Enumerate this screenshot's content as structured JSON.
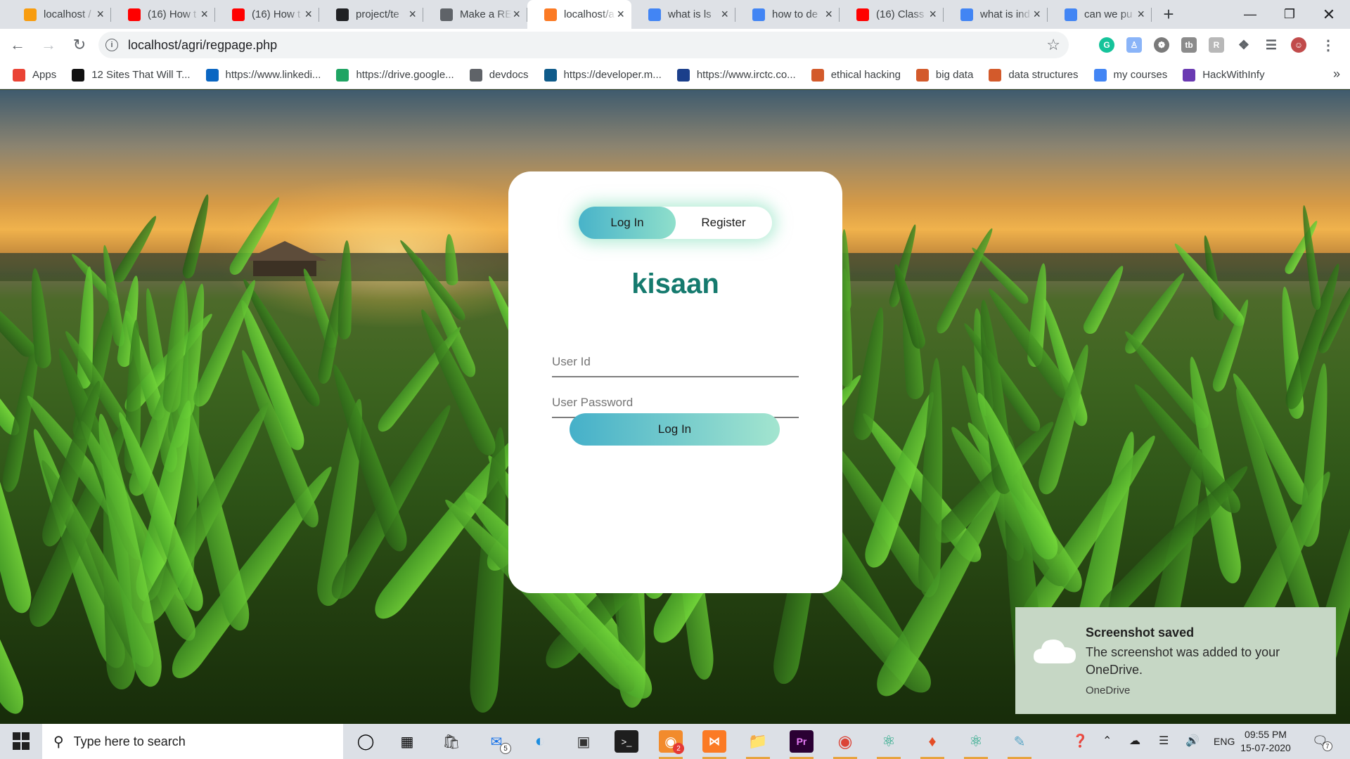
{
  "browser": {
    "tabs": [
      {
        "title": "localhost /",
        "favicon": "phpmyadmin-icon",
        "color": "#f89c0e",
        "active": false
      },
      {
        "title": "(16) How t",
        "favicon": "youtube-icon",
        "color": "#ff0000",
        "active": false
      },
      {
        "title": "(16) How t",
        "favicon": "youtube-icon",
        "color": "#ff0000",
        "active": false
      },
      {
        "title": "project/te",
        "favicon": "github-icon",
        "color": "#202124",
        "active": false
      },
      {
        "title": "Make a RE",
        "favicon": "document-icon",
        "color": "#5f6368",
        "active": false
      },
      {
        "title": "localhost/a",
        "favicon": "xampp-icon",
        "color": "#fb7a24",
        "active": true
      },
      {
        "title": "what is ls",
        "favicon": "google-icon",
        "color": "#4285f4",
        "active": false
      },
      {
        "title": "how to de",
        "favicon": "google-icon",
        "color": "#4285f4",
        "active": false
      },
      {
        "title": "(16) Class",
        "favicon": "youtube-icon",
        "color": "#ff0000",
        "active": false
      },
      {
        "title": "what is ind",
        "favicon": "google-icon",
        "color": "#4285f4",
        "active": false
      },
      {
        "title": "can we pu",
        "favicon": "google-icon",
        "color": "#4285f4",
        "active": false
      }
    ],
    "url": "localhost/agri/regpage.php",
    "bookmarks": [
      {
        "label": "Apps",
        "icon": "apps-grid-icon",
        "color": "#ea4335"
      },
      {
        "label": "12 Sites That Will T...",
        "icon": "esquire-icon",
        "color": "#111111"
      },
      {
        "label": "https://www.linkedi...",
        "icon": "linkedin-icon",
        "color": "#0a66c2"
      },
      {
        "label": "https://drive.google...",
        "icon": "google-drive-icon",
        "color": "#1fa463"
      },
      {
        "label": "devdocs",
        "icon": "devdocs-icon",
        "color": "#5f6368"
      },
      {
        "label": "https://developer.m...",
        "icon": "developer-icon",
        "color": "#0f5b8a"
      },
      {
        "label": "https://www.irctc.co...",
        "icon": "irctc-icon",
        "color": "#1b3f8b"
      },
      {
        "label": "ethical hacking",
        "icon": "course-icon",
        "color": "#d35a2b"
      },
      {
        "label": "big data",
        "icon": "course-icon",
        "color": "#d35a2b"
      },
      {
        "label": "data structures",
        "icon": "course-icon",
        "color": "#d35a2b"
      },
      {
        "label": "my courses",
        "icon": "google-icon",
        "color": "#4285f4"
      },
      {
        "label": "HackWithInfy",
        "icon": "hackwithinfy-icon",
        "color": "#6a3ab2"
      }
    ]
  },
  "page": {
    "toggle": {
      "login_label": "Log In",
      "register_label": "Register"
    },
    "brand": "kisaan",
    "user_id_placeholder": "User Id",
    "password_placeholder": "User Password",
    "submit_label": "Log In",
    "colors": {
      "brand": "#157a6e",
      "gradient_start": "#45b0c9",
      "gradient_end": "#a3e5cf"
    }
  },
  "toast": {
    "title": "Screenshot saved",
    "message": "The screenshot was added to your OneDrive.",
    "source": "OneDrive"
  },
  "taskbar": {
    "search_placeholder": "Type here to search",
    "mail_badge": "5",
    "app_badge": "2",
    "language": "ENG",
    "time": "09:55 PM",
    "date": "15-07-2020",
    "notification_count": "7"
  }
}
